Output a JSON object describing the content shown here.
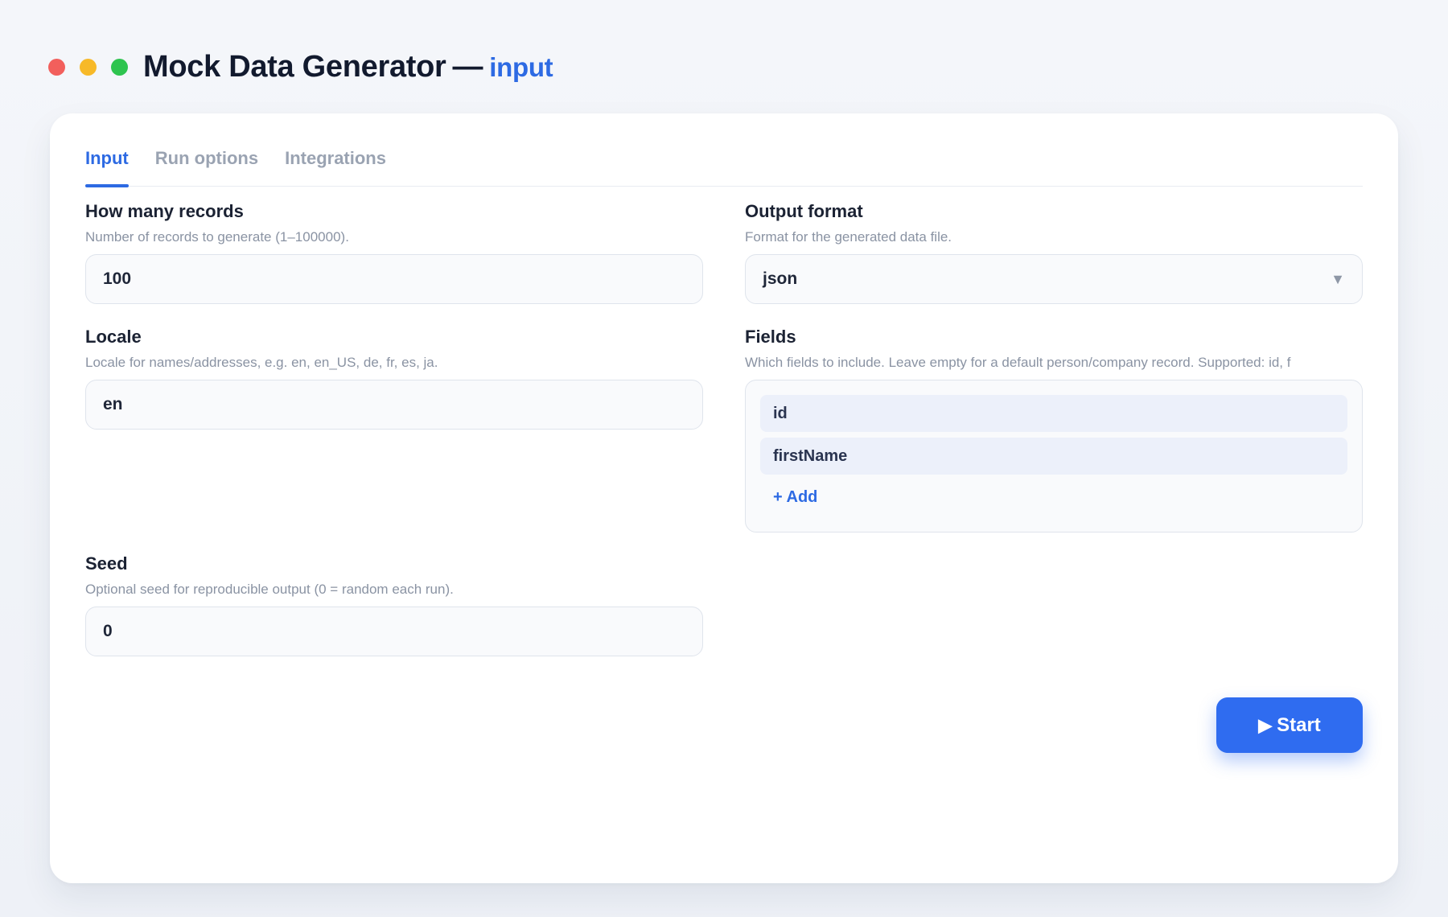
{
  "window": {
    "title": "Mock Data Generator",
    "separator": "—",
    "mode": "input",
    "controls": [
      "close",
      "minimize",
      "maximize"
    ]
  },
  "tabs": [
    {
      "label": "Input",
      "active": true
    },
    {
      "label": "Run options",
      "active": false
    },
    {
      "label": "Integrations",
      "active": false
    }
  ],
  "fields": {
    "records": {
      "label": "How many records",
      "help": "Number of records to generate (1–100000).",
      "value": "100"
    },
    "format": {
      "label": "Output format",
      "help": "Format for the generated data file.",
      "value": "json"
    },
    "locale": {
      "label": "Locale",
      "help": "Locale for names/addresses, e.g. en, en_US, de, fr, es, ja.",
      "value": "en"
    },
    "fields_list": {
      "label": "Fields",
      "help": "Which fields to include. Leave empty for a default person/company record. Supported: id, f",
      "items": [
        "id",
        "firstName"
      ],
      "add_label": "+ Add"
    },
    "seed": {
      "label": "Seed",
      "help": "Optional seed for reproducible output (0 = random each run).",
      "value": "0"
    }
  },
  "actions": {
    "start_icon": "▶",
    "start_label": "Start"
  },
  "colors": {
    "accent": "#2d6ae3",
    "button": "#2f6cf0",
    "close": "#f25f5c",
    "minimize": "#f7b928",
    "maximize": "#2ec44f"
  }
}
